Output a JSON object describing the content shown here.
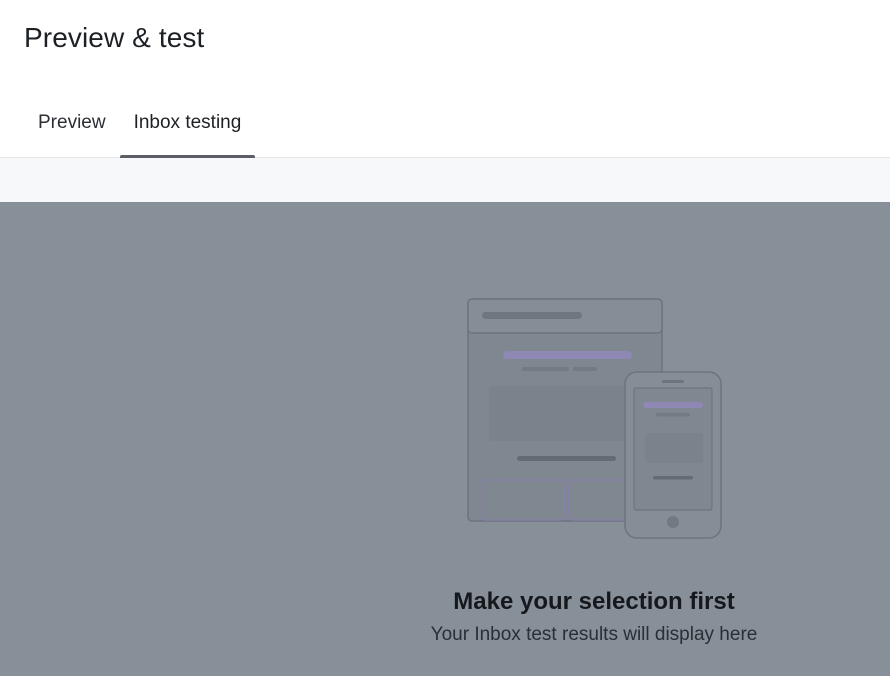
{
  "header": {
    "title": "Preview & test"
  },
  "tabs": [
    {
      "label": "Preview",
      "active": false
    },
    {
      "label": "Inbox testing",
      "active": true
    }
  ],
  "empty_state": {
    "illustration": "desktop-and-mobile-email-icon",
    "title": "Make your selection first",
    "subtitle": "Your Inbox test results will display here"
  },
  "colors": {
    "overlay": "#878f98",
    "accent_purple": "#8f88b5",
    "tab_indicator": "#5b5e64"
  }
}
